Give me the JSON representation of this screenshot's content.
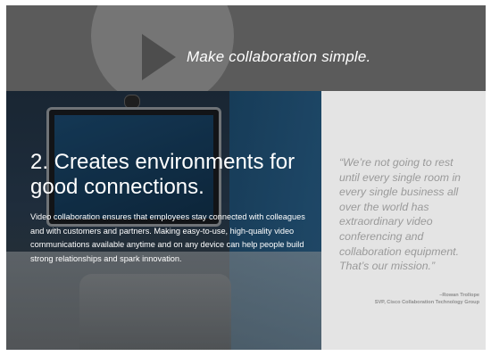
{
  "banner": {
    "tagline": "Make collaboration simple."
  },
  "section": {
    "heading": "2. Creates environments for good connections.",
    "body": "Video collaboration ensures that employees stay connected with colleagues and with customers and partners. Making easy-to-use, high-quality video communications available anytime and on any device can help people build strong relationships and spark innovation."
  },
  "quote": {
    "text": "“We’re not going to rest until every single room in every single business all over the world has extraordinary video conferencing and collaboration equipment. That’s our mission.”",
    "author": "–Rowan Trollope",
    "title": "SVP, Cisco Collaboration Technology Group"
  }
}
